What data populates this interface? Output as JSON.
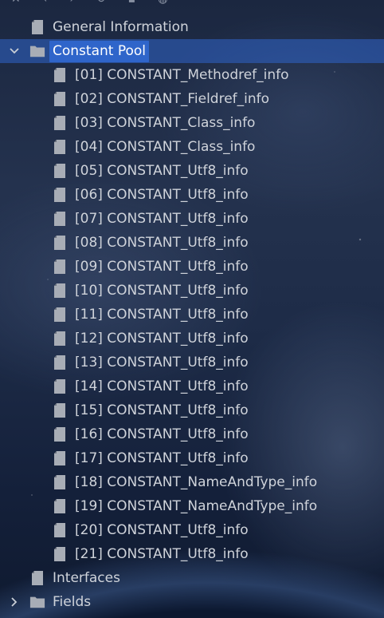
{
  "colors": {
    "selection": "#2f65ca",
    "text": "#cfd3da",
    "icon": "#a8adb6"
  },
  "tree": {
    "general_information": "General Information",
    "constant_pool": "Constant Pool",
    "entries": [
      "[01] CONSTANT_Methodref_info",
      "[02] CONSTANT_Fieldref_info",
      "[03] CONSTANT_Class_info",
      "[04] CONSTANT_Class_info",
      "[05] CONSTANT_Utf8_info",
      "[06] CONSTANT_Utf8_info",
      "[07] CONSTANT_Utf8_info",
      "[08] CONSTANT_Utf8_info",
      "[09] CONSTANT_Utf8_info",
      "[10] CONSTANT_Utf8_info",
      "[11] CONSTANT_Utf8_info",
      "[12] CONSTANT_Utf8_info",
      "[13] CONSTANT_Utf8_info",
      "[14] CONSTANT_Utf8_info",
      "[15] CONSTANT_Utf8_info",
      "[16] CONSTANT_Utf8_info",
      "[17] CONSTANT_Utf8_info",
      "[18] CONSTANT_NameAndType_info",
      "[19] CONSTANT_NameAndType_info",
      "[20] CONSTANT_Utf8_info",
      "[21] CONSTANT_Utf8_info"
    ],
    "interfaces": "Interfaces",
    "fields": "Fields"
  },
  "icons": {
    "file": "file-icon",
    "folder": "folder-icon",
    "expand": "chevron-down-icon",
    "collapse": "chevron-right-icon"
  }
}
